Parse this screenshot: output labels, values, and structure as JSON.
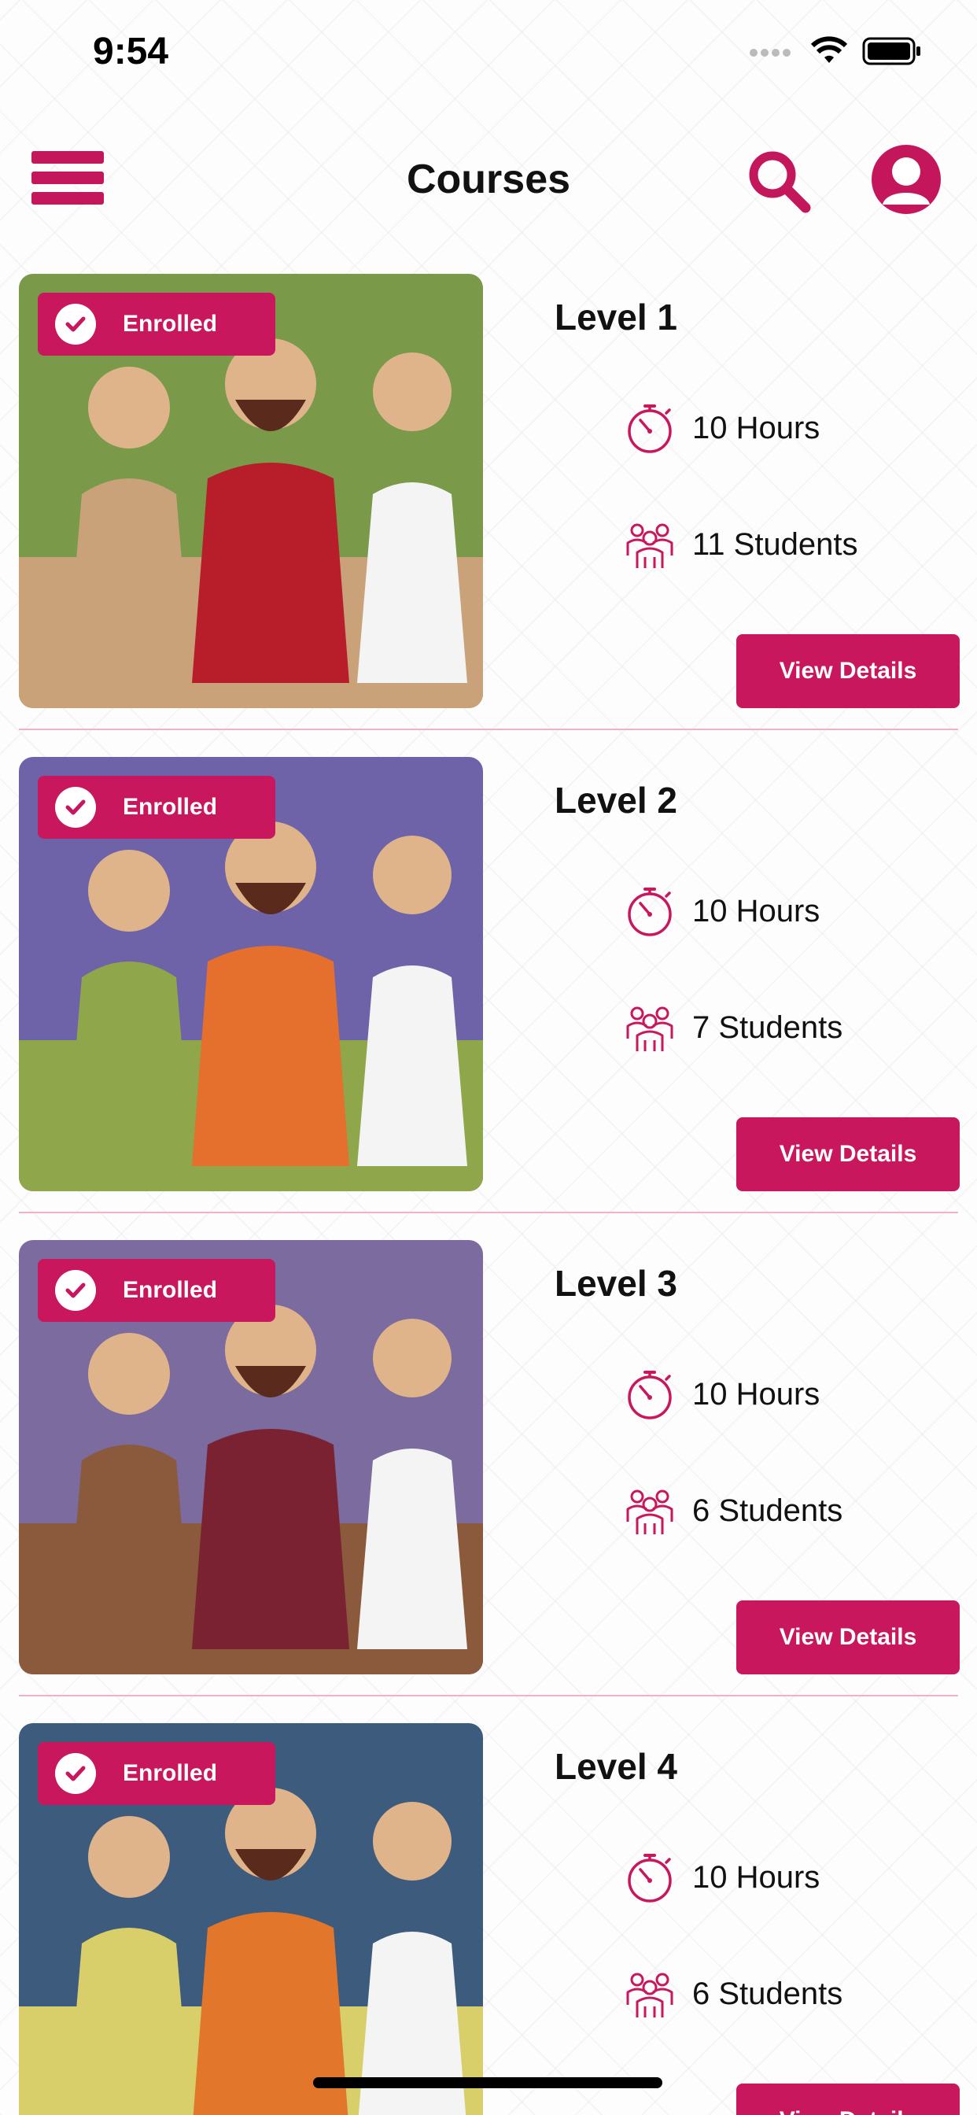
{
  "status_bar": {
    "time": "9:54"
  },
  "header": {
    "title": "Courses",
    "menu_icon": "hamburger-icon",
    "search_icon": "search-icon",
    "profile_icon": "profile-icon"
  },
  "colors": {
    "accent": "#c8175c",
    "divider": "#f0b3c4",
    "text": "#111111"
  },
  "courses": [
    {
      "badge": "Enrolled",
      "title": "Level 1",
      "hours": "10 Hours",
      "students": "11 Students",
      "button": "View Details",
      "thumb_colors": [
        "#7a9a4a",
        "#c9a27a",
        "#b81e2a"
      ]
    },
    {
      "badge": "Enrolled",
      "title": "Level 2",
      "hours": "10 Hours",
      "students": "7 Students",
      "button": "View Details",
      "thumb_colors": [
        "#6e63a8",
        "#8fa64b",
        "#e56f2d"
      ]
    },
    {
      "badge": "Enrolled",
      "title": "Level 3",
      "hours": "10 Hours",
      "students": "6 Students",
      "button": "View Details",
      "thumb_colors": [
        "#7b6b9e",
        "#8b5a3c",
        "#7a2232"
      ]
    },
    {
      "badge": "Enrolled",
      "title": "Level 4",
      "hours": "10 Hours",
      "students": "6 Students",
      "button": "View Details",
      "thumb_colors": [
        "#3d5b7c",
        "#d8cf6a",
        "#e2762b"
      ]
    }
  ]
}
